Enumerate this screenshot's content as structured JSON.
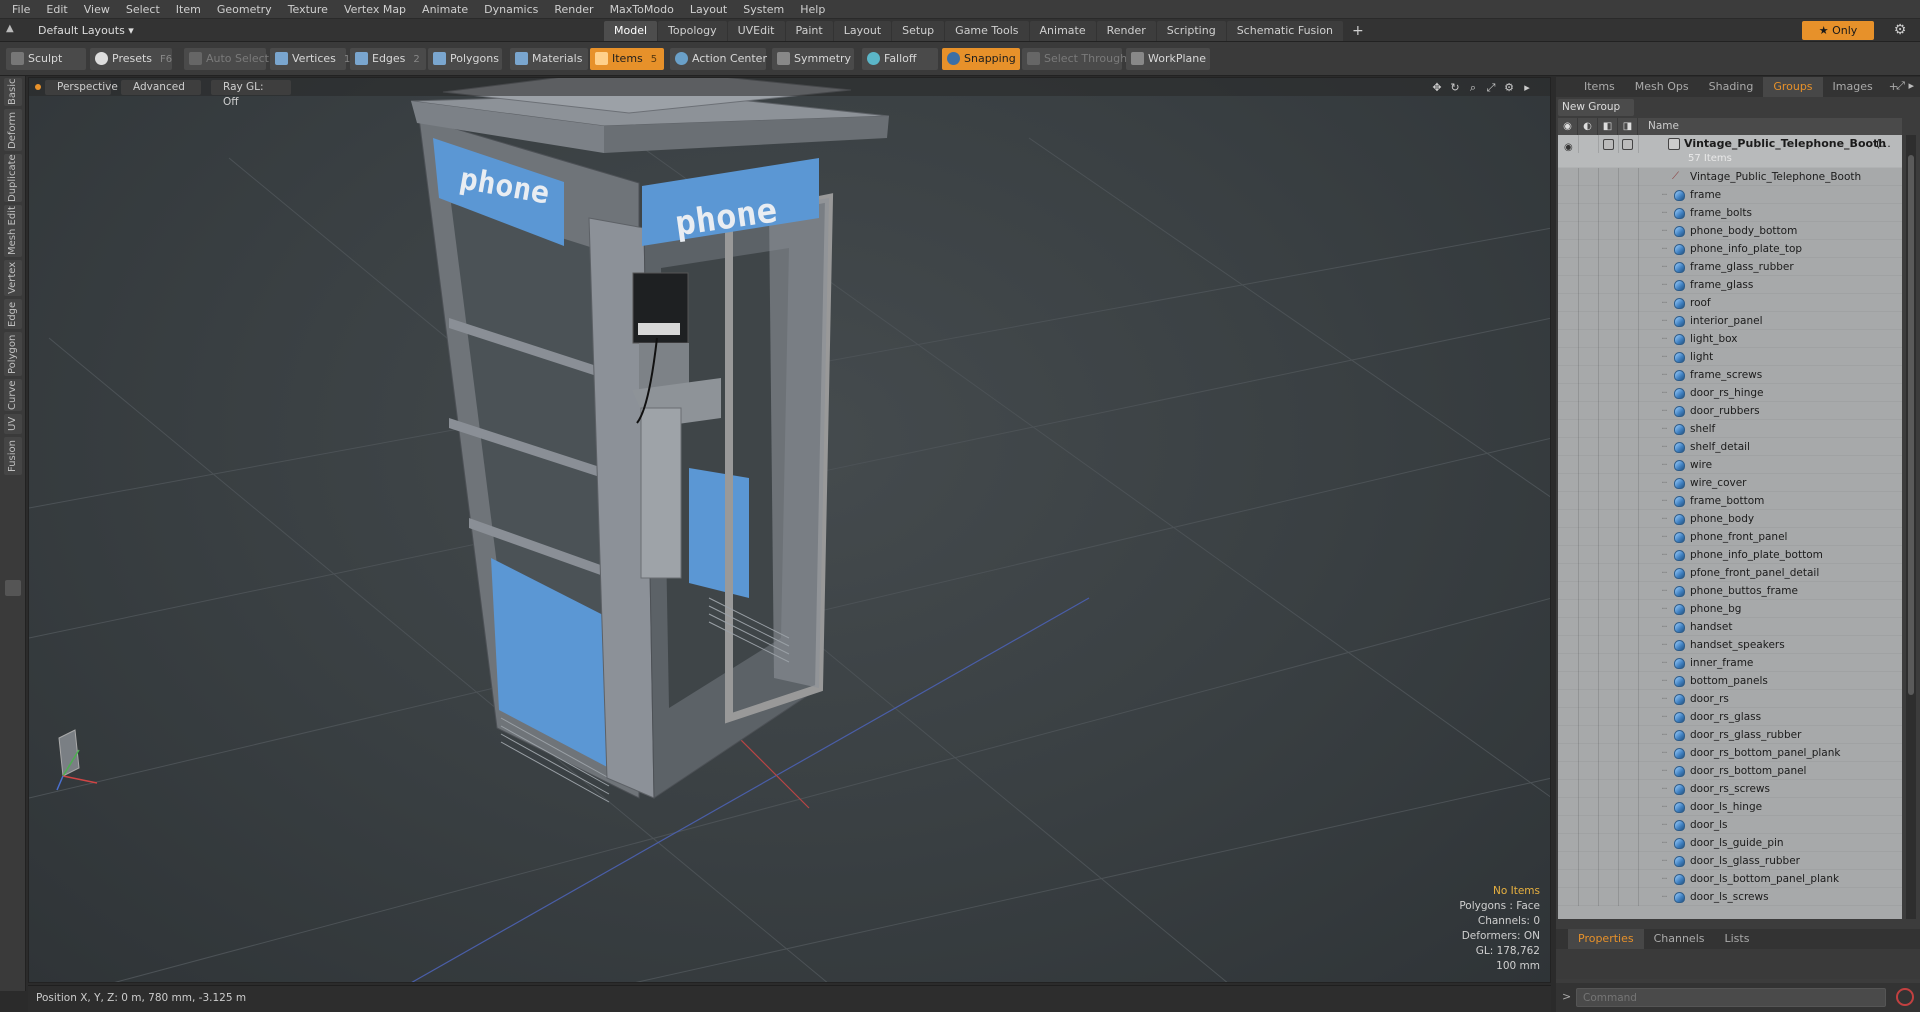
{
  "menubar": {
    "items": [
      "File",
      "Edit",
      "View",
      "Select",
      "Item",
      "Geometry",
      "Texture",
      "Vertex Map",
      "Animate",
      "Dynamics",
      "Render",
      "MaxToModo",
      "Layout",
      "System",
      "Help"
    ]
  },
  "layoutbar": {
    "layouts_label": "Default Layouts ▾",
    "tabs": [
      "Model",
      "Topology",
      "UVEdit",
      "Paint",
      "Layout",
      "Setup",
      "Game Tools",
      "Animate",
      "Render",
      "Scripting",
      "Schematic Fusion"
    ],
    "active_tab": "Model",
    "plus": "+",
    "only_label": "★ Only"
  },
  "toolbar": {
    "sculpt": "Sculpt",
    "presets": "Presets",
    "presets_key": "F6",
    "auto_select": "Auto Select",
    "vertices": "Vertices",
    "vertices_key": "1",
    "edges": "Edges",
    "edges_key": "2",
    "polygons": "Polygons",
    "materials": "Materials",
    "items": "Items",
    "items_key": "5",
    "action_center": "Action Center",
    "symmetry": "Symmetry",
    "falloff": "Falloff",
    "snapping": "Snapping",
    "select_through": "Select Through",
    "workplane": "WorkPlane"
  },
  "left_tabs": [
    "Basic",
    "Deform",
    "Duplicate",
    "Mesh Edit",
    "Vertex",
    "Edge",
    "Polygon",
    "Curve",
    "UV",
    "Fusion"
  ],
  "viewport": {
    "view": "Perspective",
    "shading": "Advanced",
    "raygl": "Ray GL: Off",
    "sign_left": "phone",
    "sign_right": "phone",
    "info": {
      "no_items": "No Items",
      "polygons": "Polygons : Face",
      "channels": "Channels: 0",
      "deformers": "Deformers: ON",
      "gl": "GL: 178,762",
      "scale": "100 mm"
    }
  },
  "status": {
    "position": "Position X, Y, Z:  0 m, 780 mm, -3.125 m"
  },
  "right_panel": {
    "tabs": [
      "Items",
      "Mesh Ops",
      "Shading",
      "Groups",
      "Images"
    ],
    "active_tab": "Groups",
    "plus": "+",
    "new_group": "New Group",
    "name_header": "Name",
    "group_name": "Vintage_Public_Telephone_Booth",
    "group_ellipsis": "(...",
    "group_count": "57 Items",
    "mesh_item": "Vintage_Public_Telephone_Booth",
    "items": [
      "frame",
      "frame_bolts",
      "phone_body_bottom",
      "phone_info_plate_top",
      "frame_glass_rubber",
      "frame_glass",
      "roof",
      "interior_panel",
      "light_box",
      "light",
      "frame_screws",
      "door_rs_hinge",
      "door_rubbers",
      "shelf",
      "shelf_detail",
      "wire",
      "wire_cover",
      "frame_bottom",
      "phone_body",
      "phone_front_panel",
      "phone_info_plate_bottom",
      "pfone_front_panel_detail",
      "phone_buttos_frame",
      "phone_bg",
      "handset",
      "handset_speakers",
      "inner_frame",
      "bottom_panels",
      "door_rs",
      "door_rs_glass",
      "door_rs_glass_rubber",
      "door_rs_bottom_panel_plank",
      "door_rs_bottom_panel",
      "door_rs_screws",
      "door_ls_hinge",
      "door_ls",
      "door_ls_guide_pin",
      "door_ls_glass_rubber",
      "door_ls_bottom_panel_plank",
      "door_ls_screws"
    ],
    "bottom_tabs": [
      "Properties",
      "Channels",
      "Lists"
    ],
    "bottom_active": "Properties",
    "command_placeholder": "Command",
    "command_prompt": ">"
  },
  "colors": {
    "accent": "#e7912a",
    "sign_blue": "#5b97d4",
    "booth_grey": "#8a8f96"
  }
}
